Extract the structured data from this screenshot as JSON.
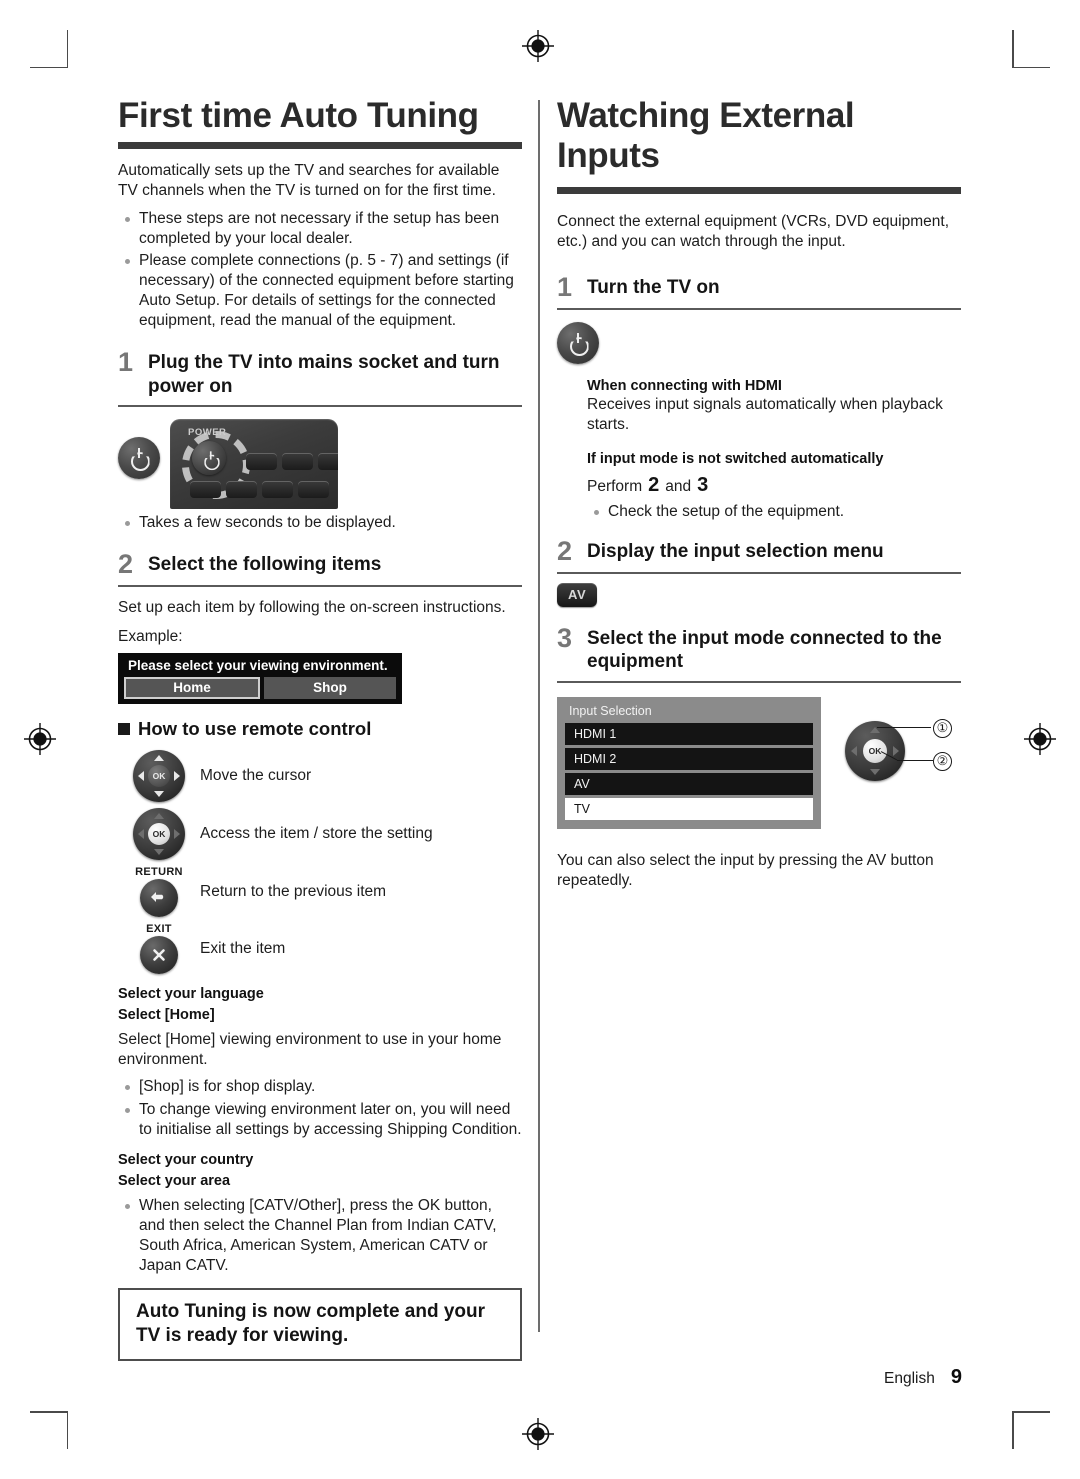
{
  "page": {
    "footer_language": "English",
    "footer_page_number": "9"
  },
  "left_column": {
    "heading": "First time Auto Tuning",
    "intro": "Automatically sets up the TV and searches for available TV channels when the TV is turned on for the first time.",
    "intro_bullets": [
      "These steps are not necessary if the setup has been completed by your local dealer.",
      "Please complete connections (p. 5 - 7) and settings (if necessary) of the connected equipment before starting Auto Setup. For details of settings for the connected equipment, read the manual of the equipment."
    ],
    "step1": {
      "number": "1",
      "title": "Plug the TV into mains socket and turn power on",
      "remote_label": "POWER",
      "note": "Takes a few seconds to be displayed."
    },
    "step2": {
      "number": "2",
      "title": "Select the following items",
      "body": "Set up each item by following the on-screen instructions.",
      "example_label": "Example:",
      "osd": {
        "title": "Please select your viewing environment.",
        "options": [
          "Home",
          "Shop"
        ],
        "selected": "Home"
      }
    },
    "remote_section": {
      "heading": "How to use remote control",
      "rows": [
        {
          "caption": "",
          "icon": "dpad-arrows-icon",
          "text": "Move the cursor"
        },
        {
          "caption": "",
          "icon": "dpad-ok-icon",
          "text": "Access the item / store the setting"
        },
        {
          "caption": "RETURN",
          "icon": "return-arrow-icon",
          "text": "Return to the previous item"
        },
        {
          "caption": "EXIT",
          "icon": "exit-cross-icon",
          "text": "Exit the item"
        }
      ]
    },
    "settings": {
      "language_head": "Select your language",
      "home_head": "Select [Home]",
      "home_body": "Select [Home] viewing environment to use in your home environment.",
      "home_bullets": [
        "[Shop] is for shop display.",
        "To change viewing environment later on, you will need to initialise all settings by accessing Shipping Condition."
      ],
      "country_head": "Select your country",
      "area_head": "Select your area",
      "area_bullets": [
        "When selecting [CATV/Other], press the OK button, and then select the Channel Plan from Indian CATV, South Africa, American System, American CATV or Japan CATV."
      ]
    },
    "callout": "Auto Tuning is now complete and your TV is ready for viewing."
  },
  "right_column": {
    "heading": "Watching External Inputs",
    "intro": "Connect the external equipment (VCRs, DVD equipment, etc.) and you can watch through the input.",
    "step1": {
      "number": "1",
      "title": "Turn the TV on",
      "hdmi_head": "When connecting with HDMI",
      "hdmi_body": "Receives input signals automatically when playback starts.",
      "manual_head": "If input mode is not switched automatically",
      "perform_prefix": "Perform",
      "perform_num1": "2",
      "perform_conj": "and",
      "perform_num2": "3",
      "bullets": [
        "Check the setup of the equipment."
      ]
    },
    "step2": {
      "number": "2",
      "title": "Display the input selection menu",
      "av_key": "AV"
    },
    "step3": {
      "number": "3",
      "title": "Select the input mode connected to the equipment",
      "input_selection": {
        "title": "Input Selection",
        "items": [
          "HDMI 1",
          "HDMI 2",
          "AV",
          "TV"
        ],
        "selected": "TV"
      },
      "callout_markers": [
        "①",
        "②"
      ],
      "footer_note": "You can also select the input by pressing the AV button repeatedly."
    }
  },
  "colors": {
    "rule_dark": "#3b3b3b",
    "step_number": "#777777",
    "osd_panel": "#8b8b8b",
    "osd_item": "#141414",
    "osd_selected": "#ffffff"
  }
}
